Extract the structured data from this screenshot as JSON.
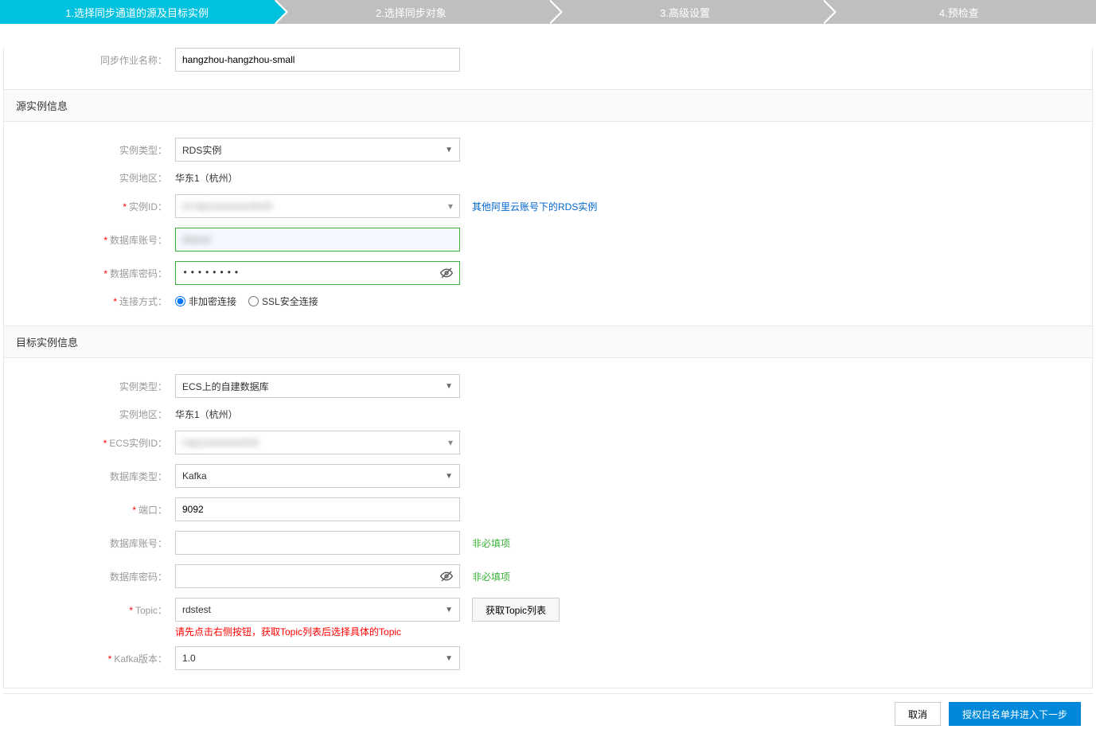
{
  "steps": {
    "s1": "1.选择同步通道的源及目标实例",
    "s2": "2.选择同步对象",
    "s3": "3.高级设置",
    "s4": "4.预检查"
  },
  "jobName": {
    "label": "同步作业名称：",
    "value": "hangzhou-hangzhou-small"
  },
  "sourceSection": {
    "title": "源实例信息",
    "instanceType": {
      "label": "实例类型：",
      "value": "RDS实例"
    },
    "region": {
      "label": "实例地区：",
      "value": "华东1（杭州）"
    },
    "instanceId": {
      "label": "实例ID：",
      "value": "rm-bp1xxxxxxxx3o23",
      "link": "其他阿里云账号下的RDS实例"
    },
    "dbAccount": {
      "label": "数据库账号：",
      "value": "dtstest"
    },
    "dbPassword": {
      "label": "数据库密码：",
      "dots": "••••••••"
    },
    "connectMode": {
      "label": "连接方式：",
      "opt1": "非加密连接",
      "opt2": "SSL安全连接"
    }
  },
  "targetSection": {
    "title": "目标实例信息",
    "instanceType": {
      "label": "实例类型：",
      "value": "ECS上的自建数据库"
    },
    "region": {
      "label": "实例地区：",
      "value": "华东1（杭州）"
    },
    "ecsId": {
      "label": "ECS实例ID：",
      "value": "i-bp1xxxxxxxxf1r8"
    },
    "dbType": {
      "label": "数据库类型：",
      "value": "Kafka"
    },
    "port": {
      "label": "端口：",
      "value": "9092"
    },
    "dbAccount": {
      "label": "数据库账号：",
      "value": "",
      "hint": "非必填项"
    },
    "dbPassword": {
      "label": "数据库密码：",
      "value": "",
      "hint": "非必填项"
    },
    "topic": {
      "label": "Topic：",
      "value": "rdstest",
      "btn": "获取Topic列表",
      "warn": "请先点击右侧按钮，获取Topic列表后选择具体的Topic"
    },
    "kafkaVer": {
      "label": "Kafka版本：",
      "value": "1.0"
    }
  },
  "footer": {
    "cancel": "取消",
    "next": "授权白名单并进入下一步"
  }
}
